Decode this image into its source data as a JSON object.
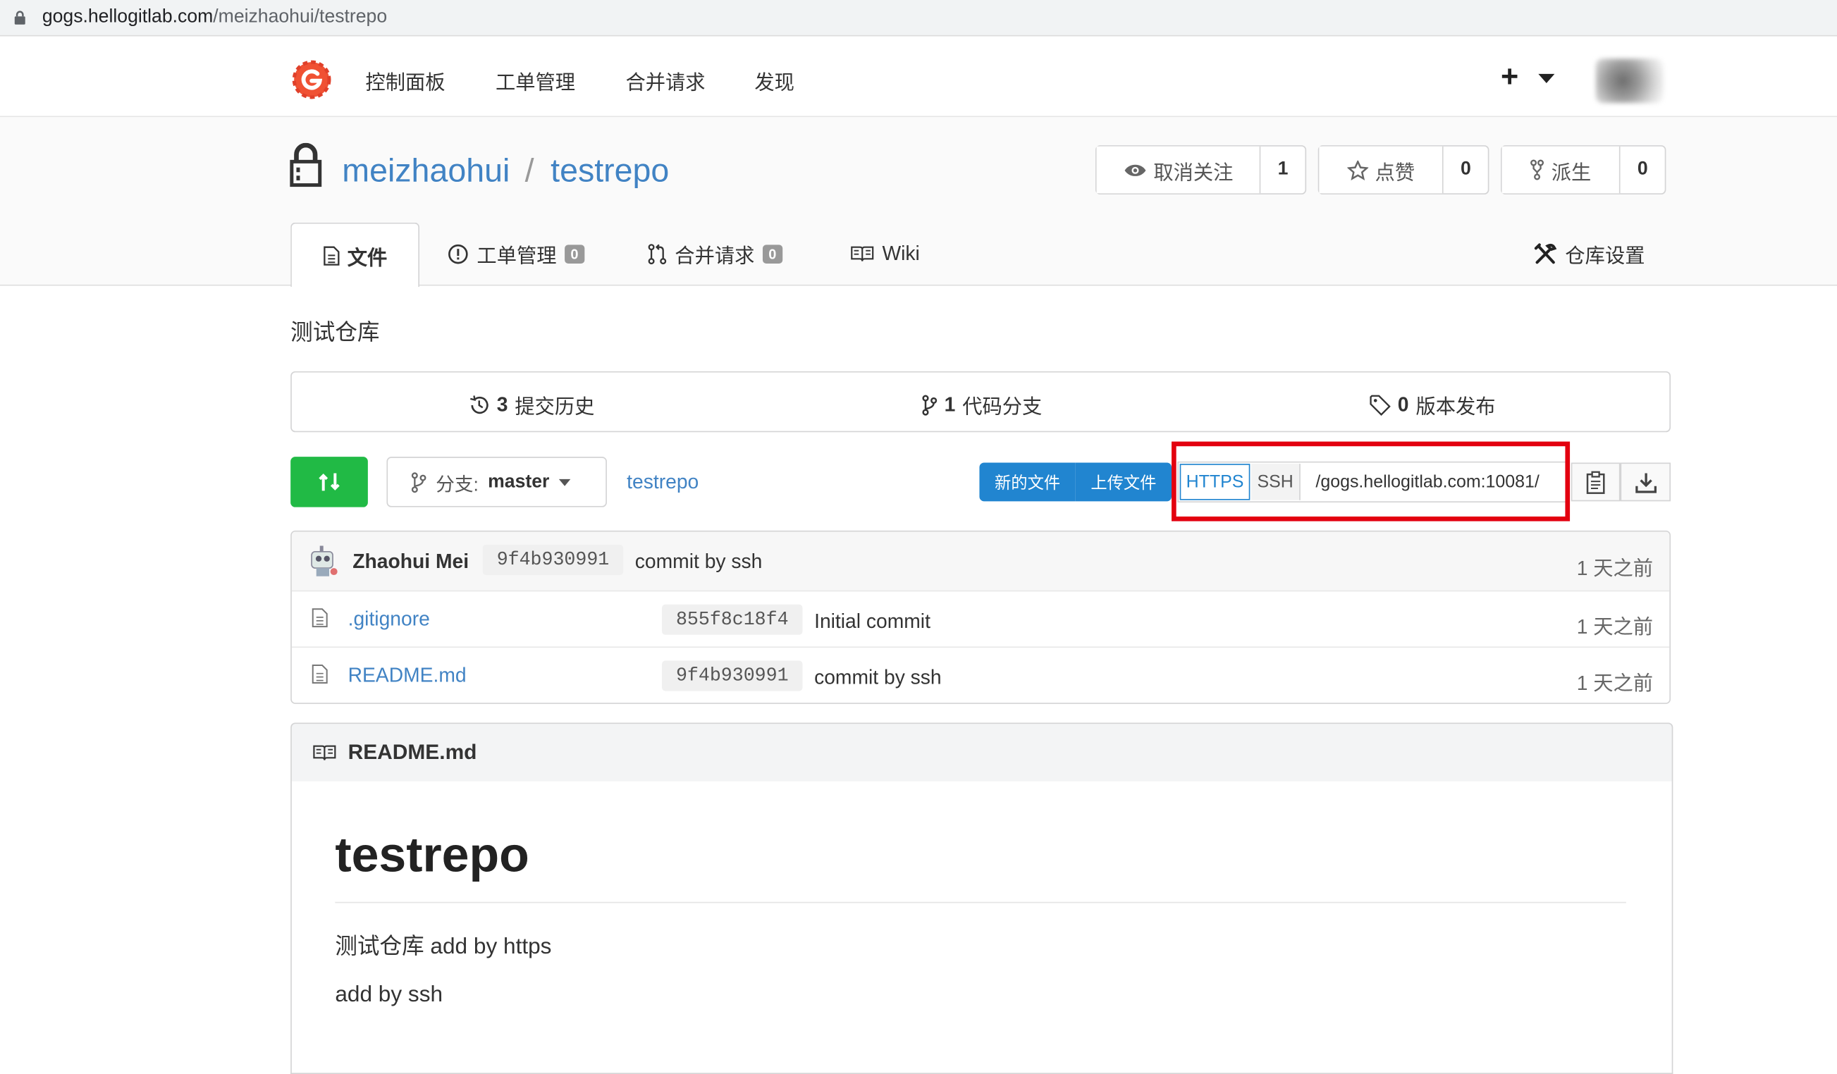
{
  "browser": {
    "url_host": "gogs.hellogitlab.com",
    "url_path": "/meizhaohui/testrepo"
  },
  "nav": {
    "items": [
      "控制面板",
      "工单管理",
      "合并请求",
      "发现"
    ],
    "plus_label": "+",
    "logo_icon": "gogs-logo-icon"
  },
  "repo": {
    "owner": "meizhaohui",
    "separator": "/",
    "name": "testrepo",
    "unwatch_label": "取消关注",
    "watch_count": "1",
    "star_label": "点赞",
    "star_count": "0",
    "fork_label": "派生",
    "fork_count": "0"
  },
  "tabs": {
    "files": "文件",
    "issues": "工单管理",
    "issues_count": "0",
    "pulls": "合并请求",
    "pulls_count": "0",
    "wiki": "Wiki",
    "settings": "仓库设置"
  },
  "description": "测试仓库",
  "stats": {
    "commits_count": "3",
    "commits_label": "提交历史",
    "branches_count": "1",
    "branches_label": "代码分支",
    "releases_count": "0",
    "releases_label": "版本发布"
  },
  "actions": {
    "branch_prefix": "分支:",
    "branch_name": "master",
    "breadcrumb": "testrepo",
    "new_file": "新的文件",
    "upload_file": "上传文件",
    "https": "HTTPS",
    "ssh": "SSH",
    "clone_url": "/gogs.hellogitlab.com:10081/"
  },
  "latest_commit": {
    "author": "Zhaohui Mei",
    "sha": "9f4b930991",
    "message": "commit by ssh",
    "when": "1 天之前"
  },
  "files": [
    {
      "name": ".gitignore",
      "sha": "855f8c18f4",
      "message": "Initial commit",
      "when": "1 天之前"
    },
    {
      "name": "README.md",
      "sha": "9f4b930991",
      "message": "commit by ssh",
      "when": "1 天之前"
    }
  ],
  "readme": {
    "filename": "README.md",
    "heading": "testrepo",
    "paragraphs": [
      "测试仓库 add by https",
      "add by ssh"
    ]
  },
  "colors": {
    "link": "#4183c4",
    "primary": "#2185d0",
    "green": "#21ba45",
    "highlight": "#e3000f",
    "logo": "#f05133"
  }
}
